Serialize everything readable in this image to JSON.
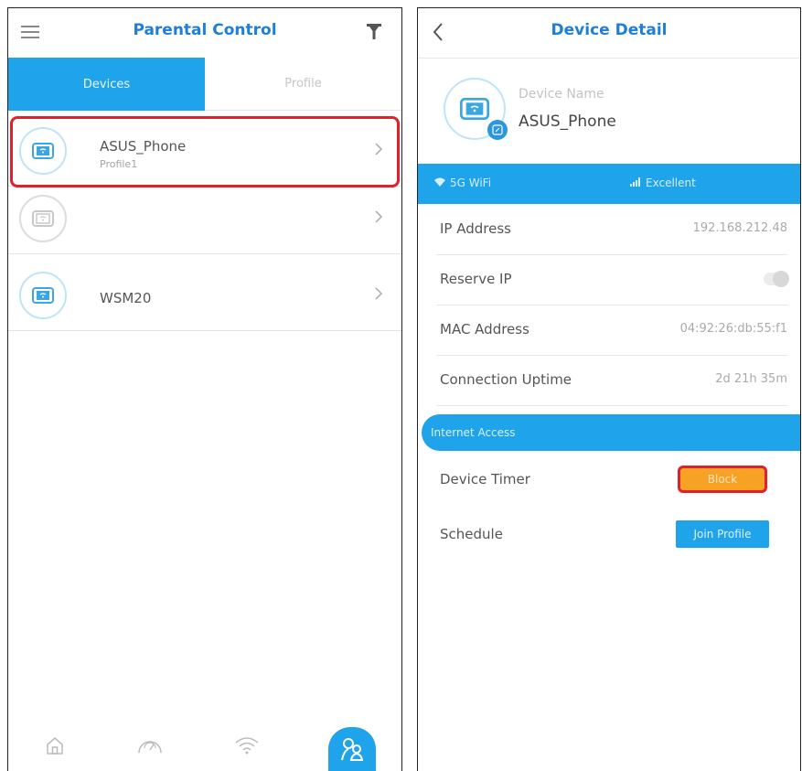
{
  "left": {
    "title": "Parental Control",
    "tabs": [
      "Devices",
      "Profile"
    ],
    "devices": [
      {
        "name": "ASUS_Phone",
        "profile": "Profile1"
      },
      {
        "name": "",
        "profile": ""
      },
      {
        "name": "WSM20",
        "profile": ""
      }
    ],
    "nav": [
      "home-icon",
      "speed-gauge-icon",
      "wifi-icon",
      "parental-control-icon"
    ]
  },
  "right": {
    "title": "Device Detail",
    "device_name_label": "Device Name",
    "device_name": "ASUS_Phone",
    "band_left": "5G WiFi",
    "band_right": "Excellent",
    "info": [
      {
        "key": "IP Address",
        "value": "192.168.212.48"
      },
      {
        "key": "Reserve IP",
        "value": ""
      },
      {
        "key": "MAC Address",
        "value": "04:92:26:db:55:f1"
      },
      {
        "key": "Connection Uptime",
        "value": "2d 21h 35m"
      }
    ],
    "section": "Internet Access",
    "device_timer_label": "Device Timer",
    "block_label": "Block",
    "schedule_label": "Schedule",
    "join_profile_label": "Join Profile"
  },
  "colors": {
    "accent": "#1fa3ea",
    "title": "#1f7fd6",
    "block": "#f7a224",
    "highlight": "#e0202a"
  }
}
